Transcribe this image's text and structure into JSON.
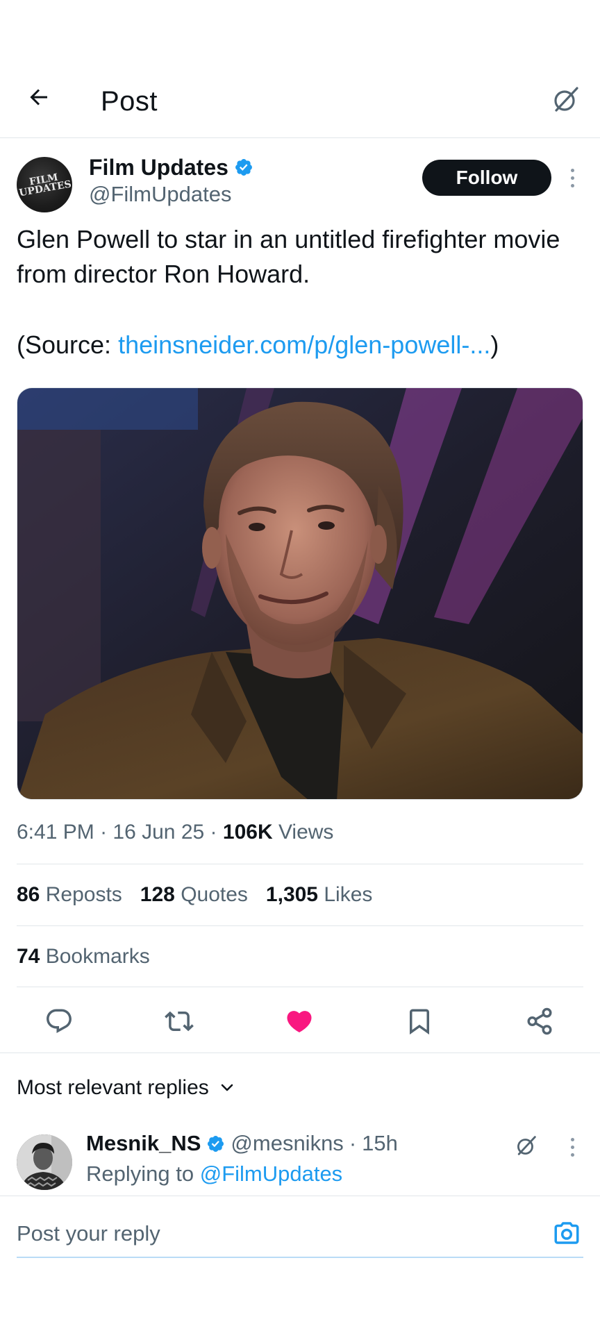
{
  "header": {
    "title": "Post",
    "back_icon": "arrow-left-icon",
    "grok_icon": "grok-icon"
  },
  "post": {
    "author": {
      "name": "Film Updates",
      "handle": "@FilmUpdates",
      "verified": true,
      "avatar_logo_text": "FILM UPDATES"
    },
    "follow_label": "Follow",
    "text": "Glen Powell to star in an untitled firefighter movie from director Ron Howard.",
    "source_prefix": "(Source: ",
    "source_link": "theinsneider.com/p/glen-powell-...",
    "source_suffix": ")",
    "image_alt": "Glen Powell",
    "time": "6:41 PM",
    "date": "16 Jun 25",
    "views_count": "106K",
    "views_label": "Views",
    "separator": "·"
  },
  "stats": {
    "reposts_count": "86",
    "reposts_label": "Reposts",
    "quotes_count": "128",
    "quotes_label": "Quotes",
    "likes_count": "1,305",
    "likes_label": "Likes",
    "bookmarks_count": "74",
    "bookmarks_label": "Bookmarks"
  },
  "actions": [
    {
      "icon": "reply-icon"
    },
    {
      "icon": "repost-icon"
    },
    {
      "icon": "heart-filled-icon",
      "active": true
    },
    {
      "icon": "bookmark-icon"
    },
    {
      "icon": "share-icon"
    }
  ],
  "replies": {
    "sort_label": "Most relevant replies",
    "items": [
      {
        "name": "Mesnik_NS",
        "handle": "@mesnikns",
        "age": "15h",
        "verified": true,
        "replying_prefix": "Replying to",
        "replying_to": "@FilmUpdates"
      }
    ]
  },
  "compose": {
    "placeholder": "Post your reply"
  },
  "colors": {
    "accent": "#1d9bf0",
    "like": "#f91880",
    "text": "#0f1419",
    "secondary": "#536471"
  }
}
